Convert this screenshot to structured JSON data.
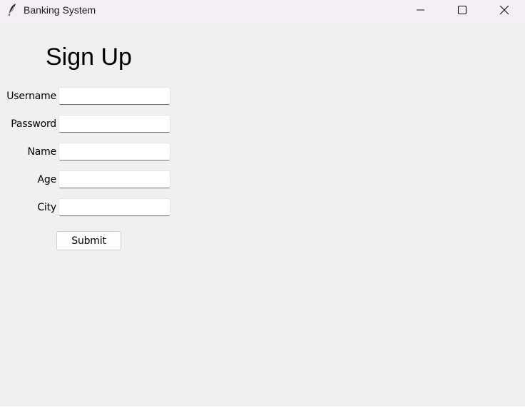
{
  "window": {
    "title": "Banking System",
    "icon": "feather-icon",
    "controls": [
      "minimize-icon",
      "maximize-icon",
      "close-icon"
    ]
  },
  "form": {
    "heading": "Sign Up",
    "fields": [
      {
        "label": "Username",
        "value": ""
      },
      {
        "label": "Password",
        "value": ""
      },
      {
        "label": "Name",
        "value": ""
      },
      {
        "label": "Age",
        "value": ""
      },
      {
        "label": "City",
        "value": ""
      }
    ],
    "submit_label": "Submit"
  }
}
